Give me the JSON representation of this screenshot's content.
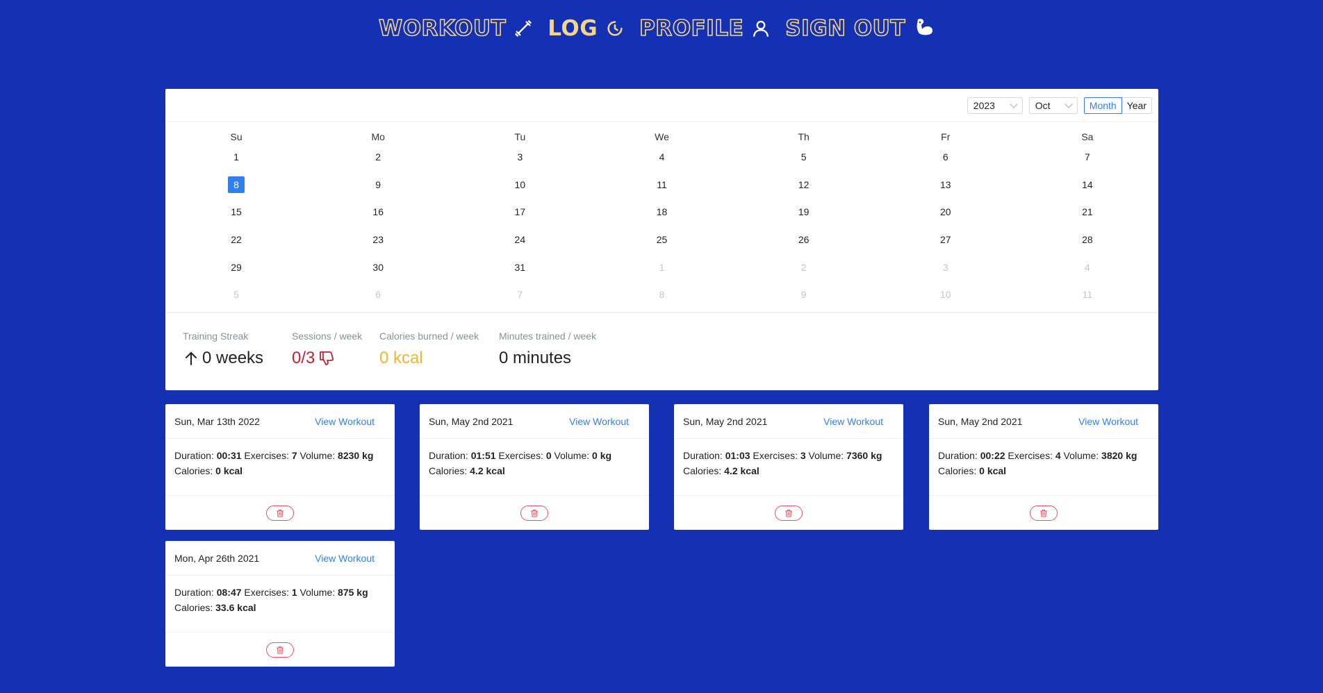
{
  "nav": {
    "items": [
      {
        "label": "WORKOUT",
        "icon": "dumbbell-icon",
        "active": false
      },
      {
        "label": "LOG",
        "icon": "history-clock-icon",
        "active": true
      },
      {
        "label": "PROFILE",
        "icon": "user-icon",
        "active": false
      },
      {
        "label": "SIGN OUT",
        "icon": "flexed-arm-icon",
        "active": false
      }
    ],
    "colors": {
      "accent": "#f4d58d",
      "background": "#1430b3"
    }
  },
  "calendar": {
    "year": "2023",
    "month": "Oct",
    "modes": [
      "Month",
      "Year"
    ],
    "active_mode": "Month",
    "weekdays": [
      "Su",
      "Mo",
      "Tu",
      "We",
      "Th",
      "Fr",
      "Sa"
    ],
    "weeks": [
      [
        {
          "d": "1"
        },
        {
          "d": "2"
        },
        {
          "d": "3"
        },
        {
          "d": "4"
        },
        {
          "d": "5"
        },
        {
          "d": "6"
        },
        {
          "d": "7"
        }
      ],
      [
        {
          "d": "8",
          "selected": true
        },
        {
          "d": "9"
        },
        {
          "d": "10"
        },
        {
          "d": "11"
        },
        {
          "d": "12"
        },
        {
          "d": "13"
        },
        {
          "d": "14"
        }
      ],
      [
        {
          "d": "15"
        },
        {
          "d": "16"
        },
        {
          "d": "17"
        },
        {
          "d": "18"
        },
        {
          "d": "19"
        },
        {
          "d": "20"
        },
        {
          "d": "21"
        }
      ],
      [
        {
          "d": "22"
        },
        {
          "d": "23"
        },
        {
          "d": "24"
        },
        {
          "d": "25"
        },
        {
          "d": "26"
        },
        {
          "d": "27"
        },
        {
          "d": "28"
        }
      ],
      [
        {
          "d": "29"
        },
        {
          "d": "30"
        },
        {
          "d": "31"
        },
        {
          "d": "1",
          "muted": true
        },
        {
          "d": "2",
          "muted": true
        },
        {
          "d": "3",
          "muted": true
        },
        {
          "d": "4",
          "muted": true
        }
      ],
      [
        {
          "d": "5",
          "muted": true
        },
        {
          "d": "6",
          "muted": true
        },
        {
          "d": "7",
          "muted": true
        },
        {
          "d": "8",
          "muted": true
        },
        {
          "d": "9",
          "muted": true
        },
        {
          "d": "10",
          "muted": true
        },
        {
          "d": "11",
          "muted": true
        }
      ]
    ],
    "selected_color": "#2f80ed"
  },
  "stats": {
    "streak": {
      "label": "Training Streak",
      "value": "0 weeks",
      "icon": "arrow-up-icon"
    },
    "sessions": {
      "label": "Sessions / week",
      "value": "0/3",
      "icon": "thumbs-down-icon",
      "color": "#c8202f"
    },
    "calories": {
      "label": "Calories burned / week",
      "value": "0 kcal",
      "color": "#f3b52e"
    },
    "minutes": {
      "label": "Minutes trained / week",
      "value": "0 minutes"
    }
  },
  "workouts": [
    {
      "date": "Sun, Mar 13th 2022",
      "link": "View Workout",
      "duration": "00:31",
      "exercises": "7",
      "volume": "8230 kg",
      "calories": "0 kcal"
    },
    {
      "date": "Sun, May 2nd 2021",
      "link": "View Workout",
      "duration": "01:51",
      "exercises": "0",
      "volume": "0 kg",
      "calories": "4.2 kcal"
    },
    {
      "date": "Sun, May 2nd 2021",
      "link": "View Workout",
      "duration": "01:03",
      "exercises": "3",
      "volume": "7360 kg",
      "calories": "4.2 kcal"
    },
    {
      "date": "Sun, May 2nd 2021",
      "link": "View Workout",
      "duration": "00:22",
      "exercises": "4",
      "volume": "3820 kg",
      "calories": "0 kcal"
    },
    {
      "date": "Mon, Apr 26th 2021",
      "link": "View Workout",
      "duration": "08:47",
      "exercises": "1",
      "volume": "875 kg",
      "calories": "33.6 kcal"
    }
  ],
  "workout_labels": {
    "duration": "Duration: ",
    "exercises": " Exercises: ",
    "volume": " Volume: ",
    "calories": "Calories: "
  },
  "delete_icon": "trash-icon"
}
